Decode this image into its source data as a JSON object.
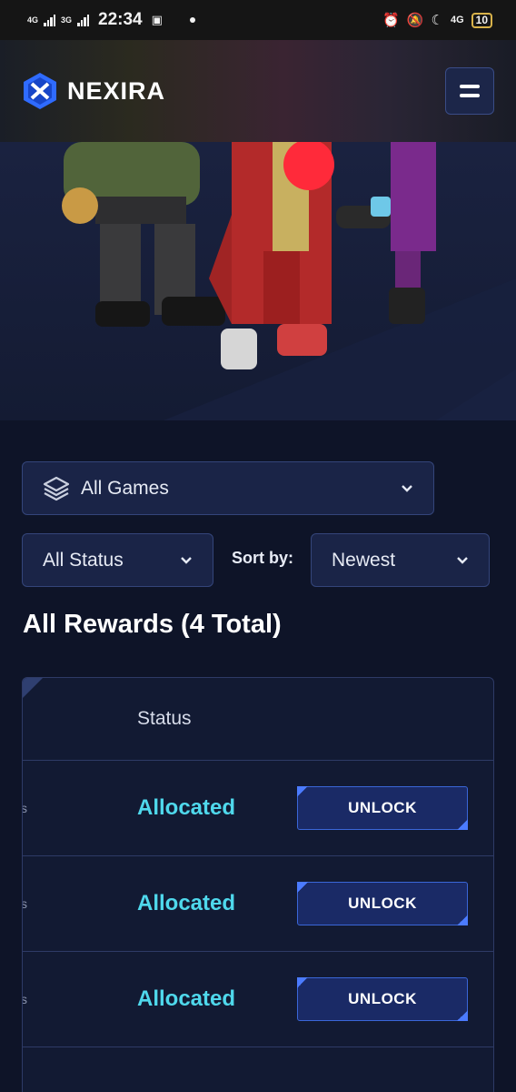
{
  "status_bar": {
    "network_1": "4G",
    "network_2": "3G",
    "time": "22:34",
    "network_3": "4G",
    "battery": "10"
  },
  "header": {
    "brand": "NEXIRA",
    "logo_icon": "nexira-logo-icon",
    "menu_icon": "hamburger-menu-icon"
  },
  "filters": {
    "games_label": "All Games",
    "status_label": "All Status",
    "sort_by_label": "Sort by:",
    "sort_value": "Newest"
  },
  "rewards": {
    "title": "All Rewards (4 Total)",
    "column_status": "Status",
    "rows": [
      {
        "edge": "s",
        "status": "Allocated",
        "action": "UNLOCK"
      },
      {
        "edge": "s",
        "status": "Allocated",
        "action": "UNLOCK"
      },
      {
        "edge": "s",
        "status": "Allocated",
        "action": "UNLOCK"
      }
    ]
  },
  "colors": {
    "background": "#0e1428",
    "accent_cyan": "#4fd8ec",
    "accent_blue": "#3a66d8",
    "panel": "#1a2447"
  }
}
